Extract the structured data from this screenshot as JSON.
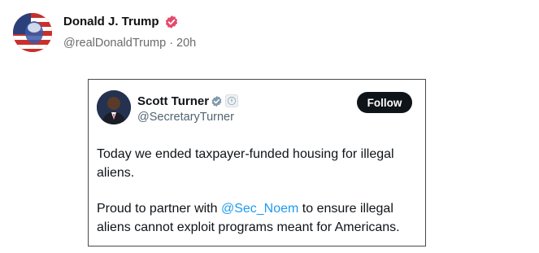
{
  "post": {
    "author_name": "Donald J. Trump",
    "handle": "@realDonaldTrump",
    "separator": "·",
    "time_ago": "20h",
    "verified_icon": "verified-badge-icon",
    "avatar_icon": "avatar-image"
  },
  "embedded_tweet": {
    "author_name": "Scott Turner",
    "handle": "@SecretaryTurner",
    "follow_label": "Follow",
    "paragraph1": "Today we ended taxpayer-funded housing for illegal aliens.",
    "paragraph2_before": "Proud to partner with ",
    "mention": "@Sec_Noem",
    "paragraph2_after": " to ensure illegal aliens cannot exploit programs meant for Americans.",
    "verified_icon": "verified-check-icon",
    "gov_icon": "government-seal-icon"
  },
  "colors": {
    "post_badge": "#e5496b",
    "mention": "#1d9bf0",
    "follow_bg": "#0f1419"
  }
}
